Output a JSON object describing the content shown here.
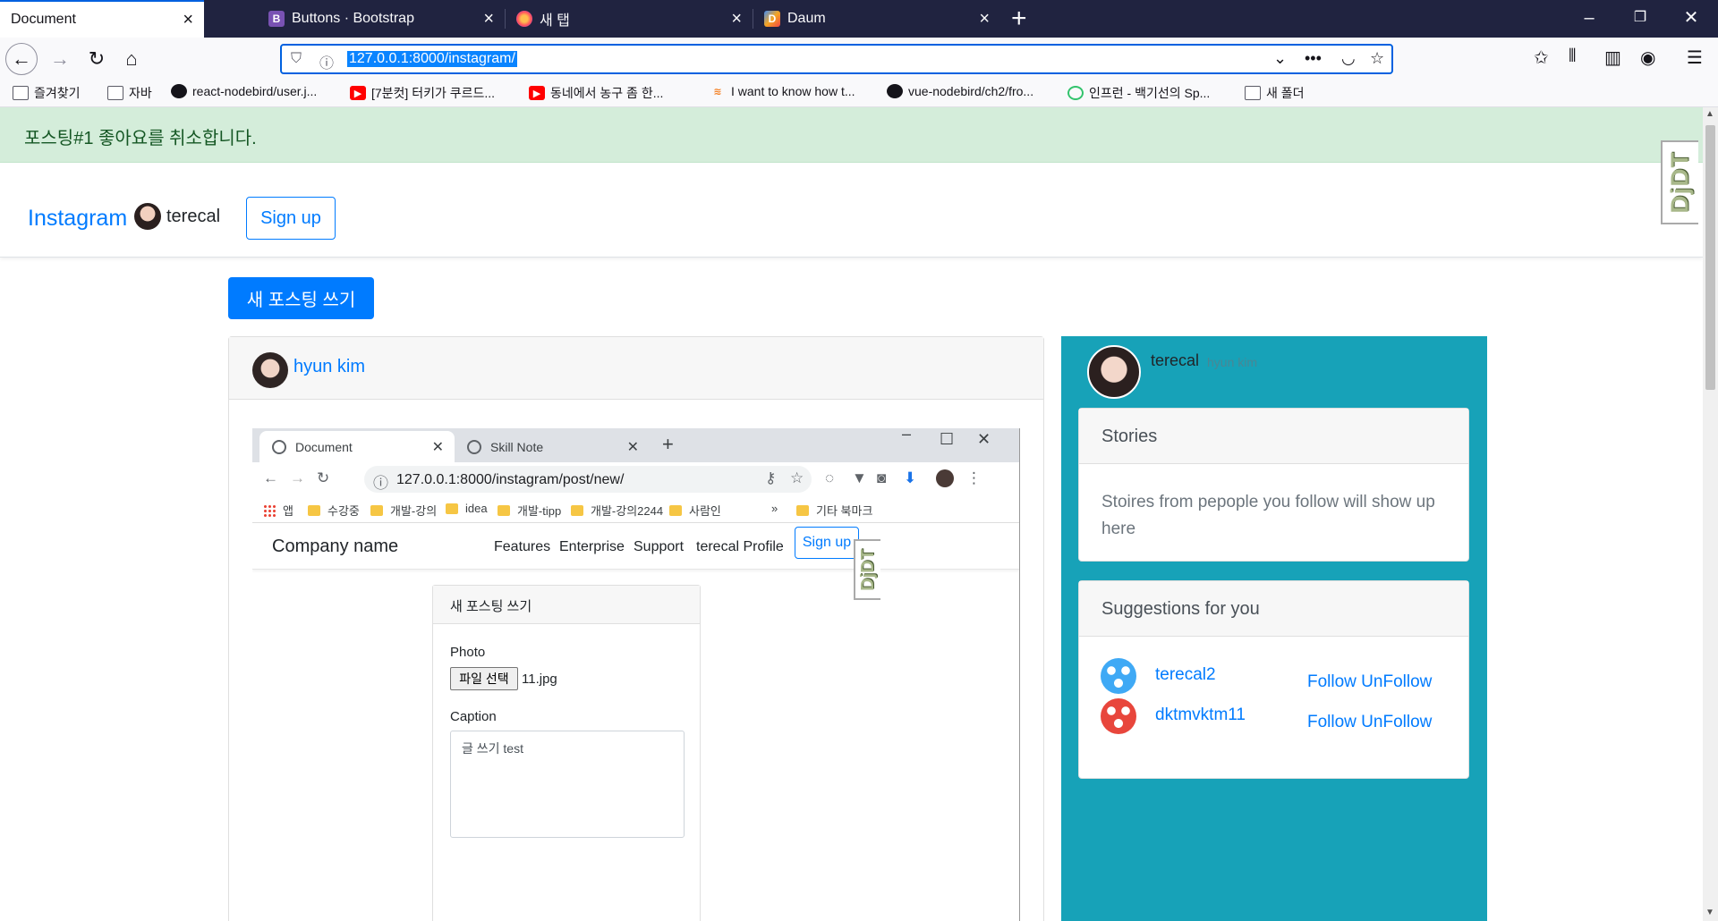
{
  "browser": {
    "tabs": [
      {
        "title": "Document",
        "icon": "none",
        "active": true
      },
      {
        "title": "Buttons · Bootstrap",
        "icon": "bootstrap-icon",
        "active": false
      },
      {
        "title": "새 탭",
        "icon": "firefox-icon",
        "active": false
      },
      {
        "title": "Daum",
        "icon": "daum-icon",
        "active": false
      }
    ],
    "url": "127.0.0.1:8000/instagram/",
    "bookmarks": [
      {
        "label": "즐겨찾기",
        "icon": "folder-icon"
      },
      {
        "label": "자바",
        "icon": "folder-icon"
      },
      {
        "label": "react-nodebird/user.j...",
        "icon": "github-icon"
      },
      {
        "label": "[7분컷] 터키가 쿠르드...",
        "icon": "youtube-icon"
      },
      {
        "label": "동네에서 농구 좀 한...",
        "icon": "youtube-icon"
      },
      {
        "label": "I want to know how t...",
        "icon": "stackoverflow-icon"
      },
      {
        "label": "vue-nodebird/ch2/fro...",
        "icon": "github-icon"
      },
      {
        "label": "인프런 - 백기선의 Sp...",
        "icon": "inflearn-icon"
      },
      {
        "label": "새 폴더",
        "icon": "folder-icon"
      }
    ]
  },
  "page": {
    "alert": "포스팅#1 좋아요를 취소합니다.",
    "djdt": "DjDT",
    "nav": {
      "brand": "Instagram",
      "username": "terecal",
      "signup": "Sign up"
    },
    "new_post_button": "새 포스팅 쓰기",
    "post": {
      "author": "hyun kim",
      "screenshot": {
        "tabs": [
          "Document",
          "Skill Note"
        ],
        "url": "127.0.0.1:8000/instagram/post/new/",
        "bookmarks": [
          "앱",
          "수강중",
          "개발-강의",
          "idea",
          "개발-tipp",
          "개발-강의2244",
          "사람인",
          "»",
          "기타 북마크"
        ],
        "company": "Company name",
        "links": [
          "Features",
          "Enterprise",
          "Support",
          "terecal Profile"
        ],
        "signup": "Sign up",
        "djdt": "DjDT",
        "form": {
          "title": "새 포스팅 쓰기",
          "photo_label": "Photo",
          "file_button": "파일 선택",
          "file_name": "11.jpg",
          "caption_label": "Caption",
          "caption_value": "글 쓰기 test"
        }
      }
    },
    "sidebar": {
      "username": "terecal",
      "fullname": "hyun kim",
      "stories": {
        "title": "Stories",
        "body": "Stoires from pepople you follow will show up here"
      },
      "suggestions": {
        "title": "Suggestions for you",
        "users": [
          {
            "name": "terecal2",
            "action": "Follow UnFollow",
            "avatar_color": "#3fa9f5"
          },
          {
            "name": "dktmvktm11",
            "action": "Follow UnFollow",
            "avatar_color": "#e8463c"
          }
        ]
      }
    }
  }
}
